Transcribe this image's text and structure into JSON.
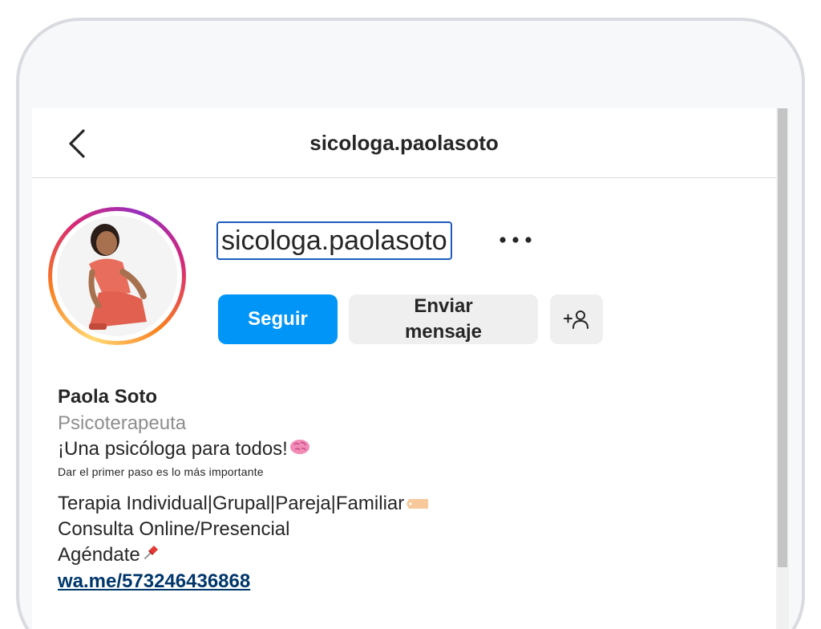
{
  "header": {
    "title": "sicologa.paolasoto"
  },
  "profile": {
    "username": "sicologa.paolasoto",
    "buttons": {
      "follow": "Seguir",
      "message_line1": "Enviar",
      "message_line2": "mensaje"
    },
    "icons": {
      "back": "chevron-left-icon",
      "more": "more-horizontal-icon",
      "add_user": "add-user-icon"
    }
  },
  "bio": {
    "name": "Paola Soto",
    "category": "Psicoterapeuta",
    "line1": "¡Una psicóloga para todos!",
    "line2": "Dar el primer paso es lo más importante",
    "line3": "Terapia Individual|Grupal|Pareja|Familiar",
    "line4": "Consulta Online/Presencial",
    "line5": "Agéndate",
    "link": "wa.me/573246436868"
  },
  "colors": {
    "primary": "#0095f6",
    "link": "#00376b",
    "secondary_text": "#8e8e8e",
    "focus_outline": "#1d5bbf"
  }
}
